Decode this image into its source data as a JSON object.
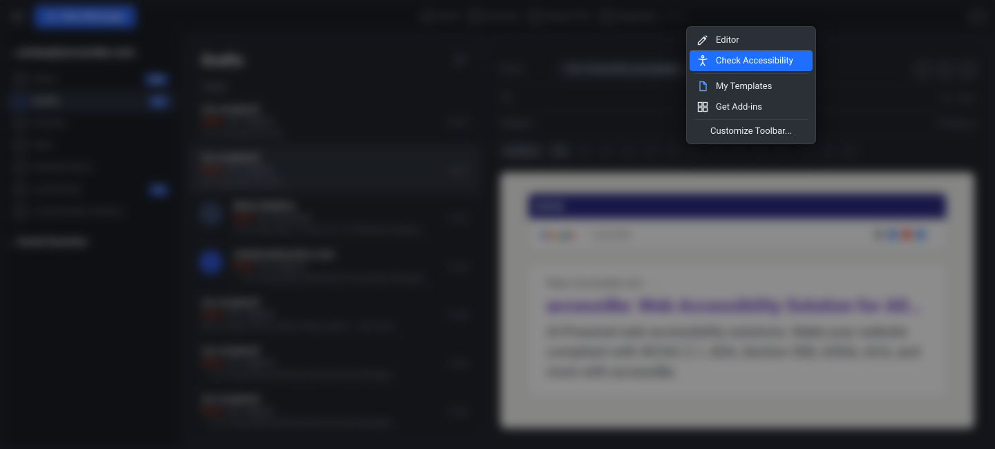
{
  "topbar": {
    "new_message": "New Message",
    "send": "Send",
    "discard": "Discard",
    "attach": "Attach File",
    "signature": "Signature"
  },
  "sidebar": {
    "account": "yoniya@accessibe.com",
    "items": [
      {
        "label": "Inbox",
        "badge": "234"
      },
      {
        "label": "Drafts",
        "badge": "47"
      },
      {
        "label": "Archive"
      },
      {
        "label": "Sent"
      },
      {
        "label": "Deleted Items"
      },
      {
        "label": "Junk Email",
        "badge": "12"
      },
      {
        "label": "Conversation History"
      }
    ],
    "saved_searches": "Saved Searches"
  },
  "list": {
    "title": "Drafts",
    "day": "Today",
    "messages": [
      {
        "from": "(no recipient)",
        "subject": "(no subject)",
        "time": "16:04",
        "preview": "(no message preview)"
      },
      {
        "from": "(no recipient)",
        "subject": "(no subject)",
        "time": "16:03",
        "preview": "(no message preview)"
      },
      {
        "from": "Marla Watkins",
        "subject": "Re: Reminder",
        "time": "11:59",
        "preview": "Hi On Wed, Sep 14, 2022 at 2:16 PM Marla Watkins…"
      },
      {
        "from": "nate@makenotion.com",
        "subject": "(no subject)",
        "time": "11:58",
        "preview": "— Yoni Yampolsky Marketing Partnerships Manager…"
      },
      {
        "from": "(no recipient)",
        "subject": "(no subject)",
        "time": "11:58",
        "preview": "New ClickUp Vision Notion Figma Slack — Yoni Yam…"
      },
      {
        "from": "(no recipient)",
        "subject": "(no subject)",
        "time": "11:56",
        "preview": "— Yoni Yampolsky Marketing Partnerships Manager…"
      },
      {
        "from": "(no recipient)",
        "subject": "(no subject)",
        "time": "11:56",
        "preview": "— Yoni Yampolsky Marketing Partnerships Manager…"
      }
    ],
    "draft_tag": "Draft"
  },
  "compose": {
    "from_label": "From:",
    "from_value": "Yoni Yampolsky (yoniya@ac…",
    "to_label": "To:",
    "cc": "Cc",
    "bcc": "Bcc",
    "subject_label": "Subject:",
    "priority": "Priority",
    "format_font": "Calibri",
    "format_size": "11"
  },
  "preview": {
    "search_term": "accessibe",
    "result_url": "https://accessibe.com",
    "result_title": "accessiBe: Web Accessibility Solution for ADA Compliance…",
    "result_desc": "AI-Powered web accessibility solutions. Make your website compliant with WCAG 2.1, ADA, Section 508, AODA, ACA, and more with accessiBe."
  },
  "context_menu": {
    "editor": "Editor",
    "check_accessibility": "Check Accessibility",
    "my_templates": "My Templates",
    "get_addins": "Get Add-ins",
    "customize": "Customize Toolbar..."
  }
}
